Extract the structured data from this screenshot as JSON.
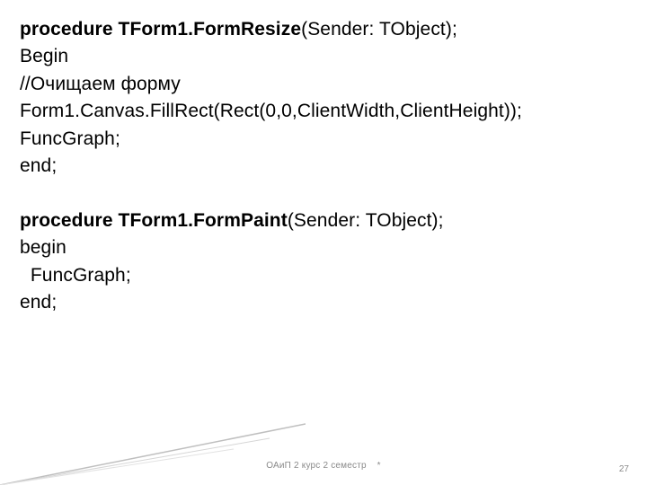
{
  "code": {
    "line1_bold": "procedure TForm1.FormResize",
    "line1_rest": "(Sender: TObject);",
    "line2": "Begin",
    "line3": "//Очищаем форму",
    "line4": "Form1.Canvas.FillRect(Rect(0,0,ClientWidth,ClientHeight));",
    "line5": "FuncGraph;",
    "line6": "end;",
    "line8_bold": "procedure TForm1.FormPaint",
    "line8_rest": "(Sender: TObject);",
    "line9": "begin",
    "line10": "  FuncGraph;",
    "line11": "end;"
  },
  "footer": {
    "course": "ОАиП 2 курс 2 семестр",
    "mark": "*",
    "page": "27"
  }
}
